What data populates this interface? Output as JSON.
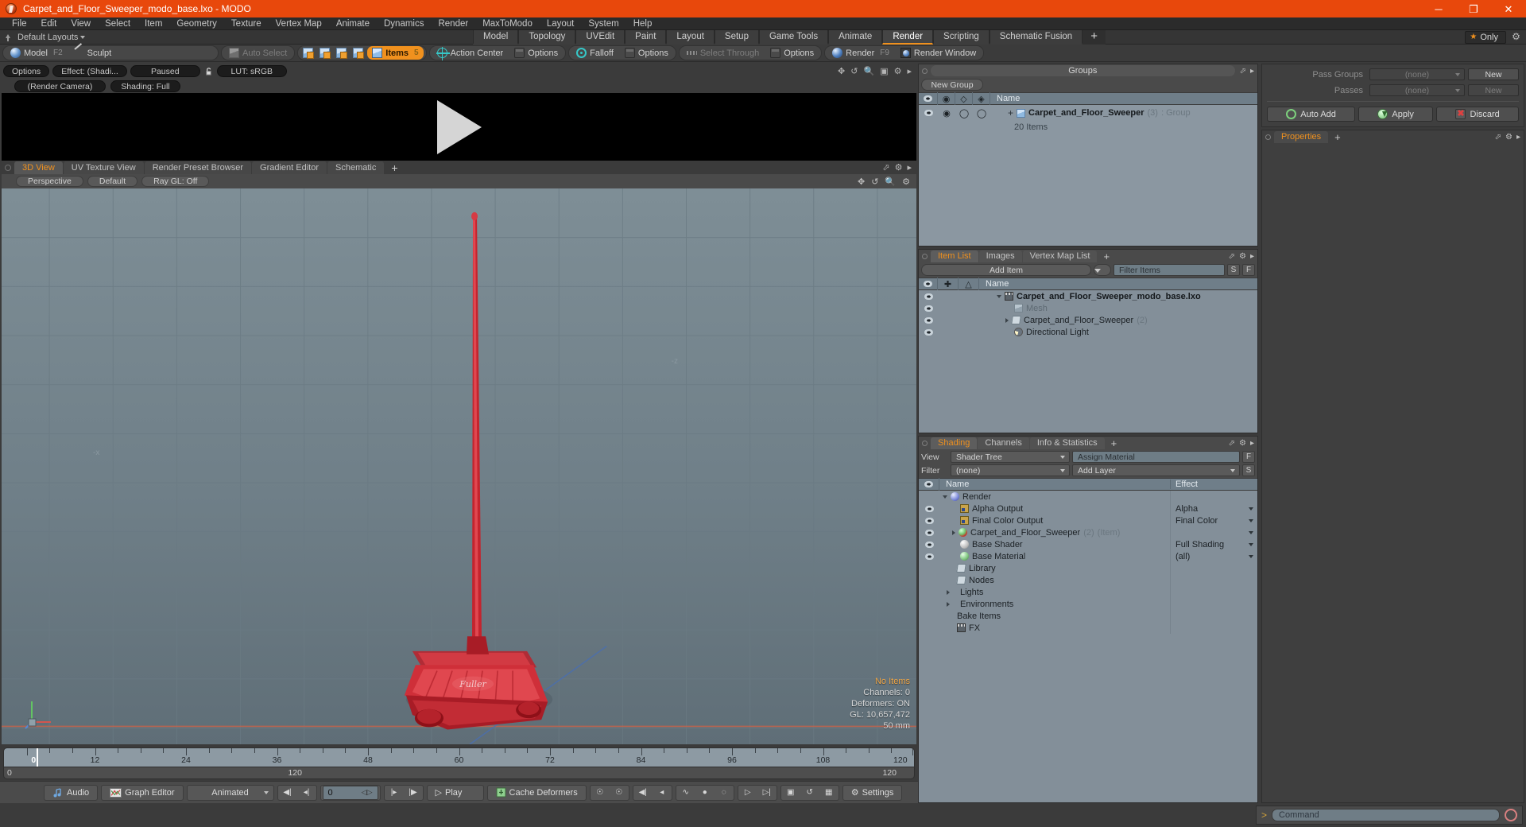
{
  "titlebar": {
    "title": "Carpet_and_Floor_Sweeper_modo_base.lxo - MODO",
    "minimize": "─",
    "maximize": "❐",
    "close": "✕"
  },
  "menubar": {
    "items": [
      "File",
      "Edit",
      "View",
      "Select",
      "Item",
      "Geometry",
      "Texture",
      "Vertex Map",
      "Animate",
      "Dynamics",
      "Render",
      "MaxToModo",
      "Layout",
      "System",
      "Help"
    ]
  },
  "layoutbar": {
    "default_layouts": "Default Layouts",
    "tabs": [
      {
        "label": "Model",
        "active": false
      },
      {
        "label": "Topology",
        "active": false
      },
      {
        "label": "UVEdit",
        "active": false
      },
      {
        "label": "Paint",
        "active": false
      },
      {
        "label": "Layout",
        "active": false
      },
      {
        "label": "Setup",
        "active": false
      },
      {
        "label": "Game Tools",
        "active": false
      },
      {
        "label": "Animate",
        "active": false
      },
      {
        "label": "Render",
        "active": true
      },
      {
        "label": "Scripting",
        "active": false
      },
      {
        "label": "Schematic Fusion",
        "active": false
      }
    ],
    "add_tab": "+",
    "only_label": "Only"
  },
  "toolbar": {
    "model": "Model",
    "model_hotkey": "F2",
    "sculpt": "Sculpt",
    "auto_select": "Auto Select",
    "items": "Items",
    "items_hotkey": "5",
    "action_center": "Action Center",
    "options_1": "Options",
    "falloff": "Falloff",
    "options_2": "Options",
    "select_through": "Select Through",
    "options_3": "Options",
    "render": "Render",
    "render_hotkey": "F9",
    "render_window": "Render Window"
  },
  "preview": {
    "options": "Options",
    "effect": "Effect: (Shadi...",
    "paused": "Paused",
    "lut": "LUT: sRGB",
    "render_camera": "(Render Camera)",
    "shading": "Shading: Full"
  },
  "viewport": {
    "tabs": [
      {
        "label": "3D View",
        "active": true
      },
      {
        "label": "UV Texture View",
        "active": false
      },
      {
        "label": "Render Preset Browser",
        "active": false
      },
      {
        "label": "Gradient Editor",
        "active": false
      },
      {
        "label": "Schematic",
        "active": false
      }
    ],
    "add_tab": "+",
    "perspective": "Perspective",
    "default": "Default",
    "raygl": "Ray GL: Off",
    "axis_label_z": "-z",
    "axis_label_x": "-x",
    "hud": {
      "no_items": "No Items",
      "channels": "Channels: 0",
      "deformers": "Deformers: ON",
      "gl": "GL: 10,657,472",
      "scale": "50 mm"
    }
  },
  "timeline": {
    "ticks": [
      {
        "label": "0",
        "value": 0
      },
      {
        "label": "12",
        "value": 12
      },
      {
        "label": "24",
        "value": 24
      },
      {
        "label": "36",
        "value": 36
      },
      {
        "label": "48",
        "value": 48
      },
      {
        "label": "60",
        "value": 60
      },
      {
        "label": "72",
        "value": 72
      },
      {
        "label": "84",
        "value": 84
      },
      {
        "label": "96",
        "value": 96
      },
      {
        "label": "108",
        "value": 108
      },
      {
        "label": "120",
        "value": 120
      }
    ],
    "range_start": "0",
    "range_end": "120",
    "range_end_2": "120",
    "cursor_frame": "0",
    "min": 0,
    "max": 120
  },
  "transport": {
    "audio": "Audio",
    "graph_editor": "Graph Editor",
    "animated": "Animated",
    "current_frame": "0",
    "play": "Play",
    "cache_deformers": "Cache Deformers",
    "settings": "Settings"
  },
  "groups_panel": {
    "title": "Groups",
    "new_group": "New Group",
    "columns": [
      "Name"
    ],
    "rows": [
      {
        "name": "Carpet_and_Floor_Sweeper",
        "count": "(3)",
        "suffix": ": Group",
        "sub": "20 Items"
      }
    ]
  },
  "item_list_panel": {
    "tabs": [
      {
        "label": "Item List",
        "active": true
      },
      {
        "label": "Images",
        "active": false
      },
      {
        "label": "Vertex Map List",
        "active": false
      }
    ],
    "add_tab": "+",
    "add_item": "Add Item",
    "filter_items": "Filter Items",
    "btn_s": "S",
    "btn_f": "F",
    "column_name": "Name",
    "rows": [
      {
        "name": "Carpet_and_Floor_Sweeper_modo_base.lxo",
        "icon": "film-icon",
        "indent": 0,
        "bold": true,
        "count": "",
        "expanded": true
      },
      {
        "name": "Mesh",
        "icon": "cube-icon",
        "indent": 1,
        "bold": false,
        "count": "",
        "dim": true
      },
      {
        "name": "Carpet_and_Floor_Sweeper",
        "icon": "folder-icon",
        "indent": 1,
        "bold": false,
        "count": "(2)",
        "collapsed": true
      },
      {
        "name": "Directional Light",
        "icon": "light-icon",
        "indent": 1,
        "bold": false,
        "count": ""
      }
    ]
  },
  "shading_panel": {
    "tabs": [
      {
        "label": "Shading",
        "active": true
      },
      {
        "label": "Channels",
        "active": false
      },
      {
        "label": "Info & Statistics",
        "active": false
      }
    ],
    "add_tab": "+",
    "view_label": "View",
    "view_value": "Shader Tree",
    "assign_material": "Assign Material",
    "btn_f": "F",
    "filter_label": "Filter",
    "filter_value": "(none)",
    "add_layer": "Add Layer",
    "btn_s": "S",
    "columns": {
      "name": "Name",
      "effect": "Effect"
    },
    "rows": [
      {
        "name": "Render",
        "icon": "blue-ball-icon",
        "indent": 0,
        "effect": "",
        "expanded": true,
        "eye": false
      },
      {
        "name": "Alpha Output",
        "icon": "image-icon",
        "indent": 1,
        "effect": "Alpha",
        "eye": true
      },
      {
        "name": "Final Color Output",
        "icon": "image-icon",
        "indent": 1,
        "effect": "Final Color",
        "eye": true
      },
      {
        "name": "Carpet_and_Floor_Sweeper",
        "count": "(2)",
        "suffix": "(Item)",
        "icon": "red-ball-icon",
        "indent": 1,
        "effect": "",
        "collapsed": true,
        "eye": true
      },
      {
        "name": "Base Shader",
        "icon": "white-ball-icon",
        "indent": 1,
        "effect": "Full Shading",
        "eye": true
      },
      {
        "name": "Base Material",
        "icon": "green-ball-icon",
        "indent": 1,
        "effect": "(all)",
        "eye": true
      },
      {
        "name": "Library",
        "icon": "folder-icon",
        "indent": 1,
        "effect": "",
        "eye": false
      },
      {
        "name": "Nodes",
        "icon": "folder-icon",
        "indent": 1,
        "effect": "",
        "eye": false
      },
      {
        "name": "Lights",
        "icon": "none",
        "indent": 0,
        "effect": "",
        "collapsed": true,
        "eye": false
      },
      {
        "name": "Environments",
        "icon": "none",
        "indent": 0,
        "effect": "",
        "collapsed": true,
        "eye": false
      },
      {
        "name": "Bake Items",
        "icon": "none",
        "indent": 0,
        "effect": "",
        "eye": false
      },
      {
        "name": "FX",
        "icon": "film-icon",
        "indent": 0,
        "effect": "",
        "eye": false
      }
    ]
  },
  "properties_panel": {
    "pass_groups_label": "Pass Groups",
    "pass_groups_value": "(none)",
    "pass_groups_new": "New",
    "passes_label": "Passes",
    "passes_value": "(none)",
    "passes_new": "New",
    "auto_add": "Auto Add",
    "apply": "Apply",
    "discard": "Discard",
    "tab_properties": "Properties",
    "add_tab": "+"
  },
  "command_bar": {
    "prompt": ">",
    "placeholder": "Command"
  },
  "colors": {
    "accent_orange": "#f0911e",
    "title_bar": "#e8480c",
    "panel_bg": "#4a4a4a",
    "tree_bg": "#838f99",
    "viewport_top": "#7b8b93"
  }
}
